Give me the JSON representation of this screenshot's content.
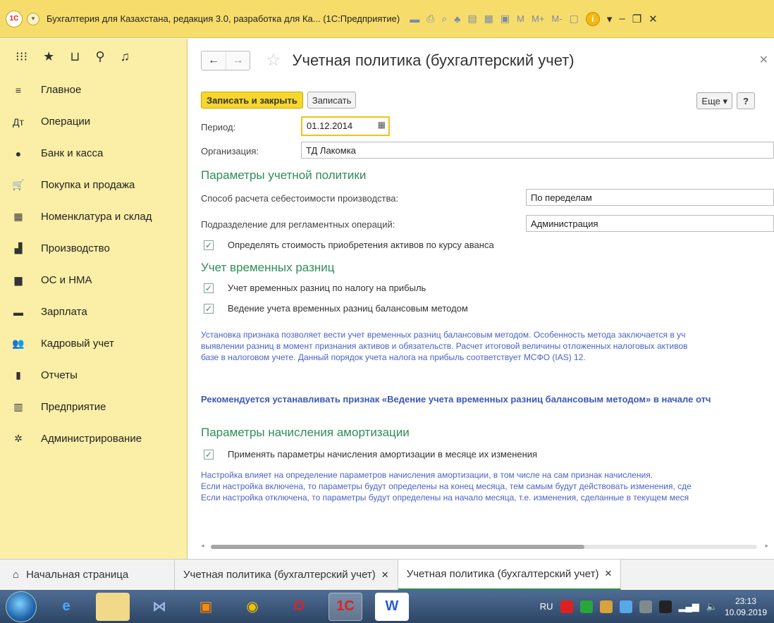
{
  "titlebar": {
    "title": "Бухгалтерия для Казахстана, редакция 3.0, разработка для Ка... (1С:Предприятие)",
    "logo_text": "1С",
    "m_buttons": [
      "M",
      "M+",
      "M-"
    ]
  },
  "sidebar": {
    "items": [
      {
        "icon": "menu-icon",
        "glyph": "≡",
        "label": "Главное"
      },
      {
        "icon": "operations-icon",
        "glyph": "Дт",
        "label": "Операции"
      },
      {
        "icon": "bank-icon",
        "glyph": "●",
        "label": "Банк и касса"
      },
      {
        "icon": "cart-icon",
        "glyph": "🛒",
        "label": "Покупка и продажа"
      },
      {
        "icon": "warehouse-icon",
        "glyph": "▦",
        "label": "Номенклатура и склад"
      },
      {
        "icon": "production-icon",
        "glyph": "▟",
        "label": "Производство"
      },
      {
        "icon": "truck-icon",
        "glyph": "▆",
        "label": "ОС и НМА"
      },
      {
        "icon": "salary-icon",
        "glyph": "▬",
        "label": "Зарплата"
      },
      {
        "icon": "people-icon",
        "glyph": "👥",
        "label": "Кадровый учет"
      },
      {
        "icon": "reports-icon",
        "glyph": "▮",
        "label": "Отчеты"
      },
      {
        "icon": "enterprise-icon",
        "glyph": "▥",
        "label": "Предприятие"
      },
      {
        "icon": "gear-icon",
        "glyph": "✲",
        "label": "Администрирование"
      }
    ]
  },
  "header": {
    "title": "Учетная политика (бухгалтерский учет)"
  },
  "toolbar": {
    "save_close_label": "Записать и закрыть",
    "save_label": "Записать",
    "more_label": "Еще",
    "help_label": "?"
  },
  "form": {
    "period_label": "Период:",
    "period_value": "01.12.2014",
    "org_label": "Организация:",
    "org_value": "ТД Лакомка"
  },
  "section1": {
    "title": "Параметры учетной политики",
    "cost_label": "Способ расчета себестоимости производства:",
    "cost_value": "По переделам",
    "dept_label": "Подразделение для регламентных операций:",
    "dept_value": "Администрация",
    "chk_advance_label": "Определять стоимость приобретения активов по курсу аванса"
  },
  "section2": {
    "title": "Учет временных разниц",
    "chk1_label": "Учет временных разниц по налогу на прибыль",
    "chk2_label": "Ведение учета временных разниц балансовым методом",
    "note_lines": [
      "Установка признака позволяет вести учет временных разниц балансовым методом.  Особенность метода заключается в уч",
      "выявлении разниц  в момент признания активов и обязательств. Расчет итоговой величины отложенных налоговых активов",
      "базе в налоговом учете. Данный порядок учета налога на прибыль соответствует МСФО (IAS)  12."
    ],
    "recommend": "Рекомендуется устанавливать признак «Ведение учета временных разниц балансовым методом» в начале отч"
  },
  "section3": {
    "title": "Параметры начисления амортизации",
    "chk_label": "Применять параметры начисления амортизации в месяце их изменения",
    "note_lines": [
      "Настройка влияет на определение параметров начисления амортизации, в том числе на сам признак начисления.",
      "Если настройка включена, то параметры будут определены на конец месяца, тем самым будут действовать изменения, сде",
      "Если настройка отключена, то параметры будут определены на начало месяца, т.е. изменения, сделанные в текущем меся"
    ]
  },
  "tabs": {
    "home": "Начальная страница",
    "tab1": "Учетная политика (бухгалтерский учет)",
    "tab2": "Учетная политика (бухгалтерский учет)"
  },
  "taskbar": {
    "lang": "RU",
    "time": "23:13",
    "date": "10.09.2019"
  },
  "colors": {
    "titlebar": "#f6dd6b",
    "sidebar": "#fbeea6",
    "accent_green": "#2f8e56",
    "note_blue": "#4a63c8",
    "primary_button": "#f7d72c"
  }
}
